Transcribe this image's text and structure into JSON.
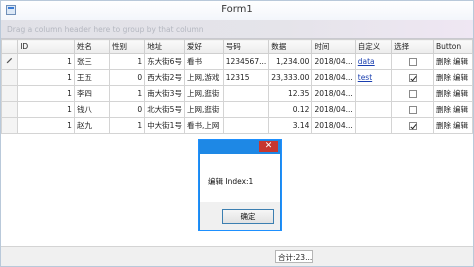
{
  "window": {
    "title": "Form1"
  },
  "group_hint": "Drag a column header here to group by that column",
  "columns": [
    "ID",
    "姓名",
    "性别",
    "地址",
    "爱好",
    "号码",
    "数据",
    "时间",
    "自定义",
    "选择",
    "Button"
  ],
  "rows": [
    {
      "id": "1",
      "name": "张三",
      "gender": "1",
      "address": "东大街6号",
      "hobby": "看书",
      "phone": "1234567...",
      "amount": "1,234.00",
      "time": "2018/04...",
      "custom": "data",
      "checked": false
    },
    {
      "id": "1",
      "name": "王五",
      "gender": "0",
      "address": "西大街2号",
      "hobby": "上网,游戏",
      "phone": "12315",
      "amount": "23,333.00",
      "time": "2018/04...",
      "custom": "test",
      "checked": true
    },
    {
      "id": "1",
      "name": "李四",
      "gender": "1",
      "address": "南大街3号",
      "hobby": "上网,逛街",
      "phone": "",
      "amount": "12.35",
      "time": "2018/04...",
      "custom": "",
      "checked": false
    },
    {
      "id": "1",
      "name": "钱八",
      "gender": "0",
      "address": "北大街5号",
      "hobby": "上网,逛街",
      "phone": "",
      "amount": "0.12",
      "time": "2018/04...",
      "custom": "",
      "checked": false
    },
    {
      "id": "1",
      "name": "赵九",
      "gender": "1",
      "address": "中大街1号",
      "hobby": "看书,上网",
      "phone": "",
      "amount": "3.14",
      "time": "2018/04...",
      "custom": "",
      "checked": true
    }
  ],
  "row_buttons": {
    "delete": "删除",
    "edit": "编辑"
  },
  "footer": {
    "total": "合计:23..."
  },
  "dialog": {
    "message": "编辑 Index:1",
    "ok_label": "确定",
    "close_glyph": "✕"
  }
}
